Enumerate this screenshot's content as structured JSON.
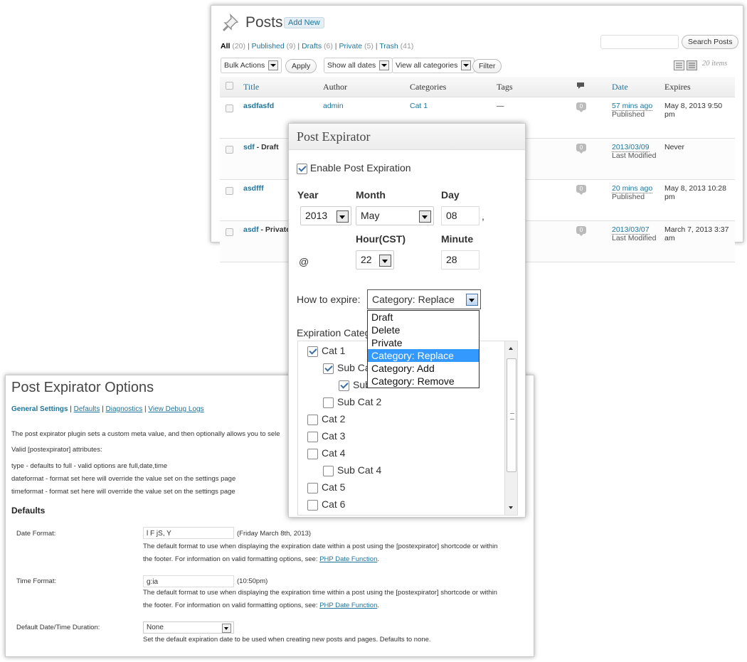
{
  "posts_screen": {
    "title": "Posts",
    "add_new": "Add New",
    "filters": {
      "all": "All",
      "all_count": "(20)",
      "published": "Published",
      "published_count": "(9)",
      "drafts": "Drafts",
      "drafts_count": "(6)",
      "private": "Private",
      "private_count": "(5)",
      "trash": "Trash",
      "trash_count": "(41)",
      "sep": "|"
    },
    "search_button": "Search Posts",
    "bulk_actions": "Bulk Actions",
    "apply_button": "Apply",
    "dates_filter": "Show all dates",
    "categories_filter": "View all categories",
    "filter_button": "Filter",
    "items_count": "20 items",
    "columns": {
      "title": "Title",
      "author": "Author",
      "categories": "Categories",
      "tags": "Tags",
      "date": "Date",
      "expires": "Expires"
    },
    "rows": [
      {
        "title": "asdfasfd",
        "state": "",
        "author": "admin",
        "category": "Cat 1",
        "tags": "—",
        "comments": "0",
        "date": "57 mins ago",
        "status": "Published",
        "expires": "May 8, 2013 9:50 pm"
      },
      {
        "title": "sdf",
        "state": " - Draft",
        "author": "",
        "category": "",
        "tags": "",
        "comments": "0",
        "date": "2013/03/09",
        "status": "Last Modified",
        "expires": "Never"
      },
      {
        "title": "asdfff",
        "state": "",
        "author": "",
        "category": "",
        "tags": "",
        "comments": "0",
        "date": "20 mins ago",
        "status": "Published",
        "expires": "May 8, 2013 10:28 pm"
      },
      {
        "title": "asdf",
        "state": " - Private",
        "author": "",
        "category": "",
        "tags": "",
        "comments": "0",
        "date": "2013/03/07",
        "status": "Last Modified",
        "expires": "March 7, 2013 3:37 am"
      }
    ]
  },
  "post_expirator": {
    "title": "Post Expirator",
    "enable_label": "Enable Post Expiration",
    "year_label": "Year",
    "month_label": "Month",
    "day_label": "Day",
    "year_value": "2013",
    "month_value": "May",
    "day_value": "08",
    "comma": ",",
    "at": "@",
    "hour_label": "Hour(CST)",
    "minute_label": "Minute",
    "hour_value": "22",
    "minute_value": "28",
    "how_label": "How to expire:",
    "how_value": "Category: Replace",
    "how_options": [
      "Draft",
      "Delete",
      "Private",
      "Category: Replace",
      "Category: Add",
      "Category: Remove"
    ],
    "exp_cat_label": "Expiration Categories",
    "categories": [
      {
        "label": "Cat 1",
        "checked": true
      },
      {
        "label": "Sub Cat 1",
        "checked": true
      },
      {
        "label": "Sub Sub Cat 1",
        "checked": true
      },
      {
        "label": "Sub Cat 2",
        "checked": false
      },
      {
        "label": "Cat 2",
        "checked": false
      },
      {
        "label": "Cat 3",
        "checked": false
      },
      {
        "label": "Cat 4",
        "checked": false
      },
      {
        "label": "Sub Cat 4",
        "checked": false
      },
      {
        "label": "Cat 5",
        "checked": false
      },
      {
        "label": "Cat 6",
        "checked": false
      }
    ]
  },
  "options_page": {
    "title": "Post Expirator Options",
    "nav": {
      "general": "General Settings",
      "defaults": "Defaults",
      "diagnostics": "Diagnostics",
      "debug": "View Debug Logs",
      "sep": "|"
    },
    "intro": "The post expirator plugin sets a custom meta value, and then optionally allows you to sele",
    "valid_attrs": "Valid [postexpirator] attributes:",
    "attr_type": "type - defaults to full - valid options are full,date,time",
    "attr_dateformat": "dateformat - format set here will override the value set on the settings page",
    "attr_timeformat": "timeformat - format set here will override the value set on the settings page",
    "defaults_heading": "Defaults",
    "date_format_label": "Date Format:",
    "date_format_value": "l F jS, Y",
    "date_format_example": "(Friday March 8th, 2013)",
    "date_help_1": "The default format to use when displaying the expiration date within a post using the [postexpirator] shortcode or within",
    "date_help_2": "the footer. For information on valid formatting options, see:",
    "php_date_link": "PHP Date Function",
    "time_format_label": "Time Format:",
    "time_format_value": "g:ia",
    "time_format_example": "(10:50pm)",
    "time_help_1": "The default format to use when displaying the expiration time within a post using the [postexpirator] shortcode or within",
    "time_help_2": "the footer. For information on valid formatting options, see:",
    "duration_label": "Default Date/Time Duration:",
    "duration_value": "None",
    "duration_help": "Set the default expiration date to be used when creating new posts and pages. Defaults to none.",
    "period": "."
  }
}
